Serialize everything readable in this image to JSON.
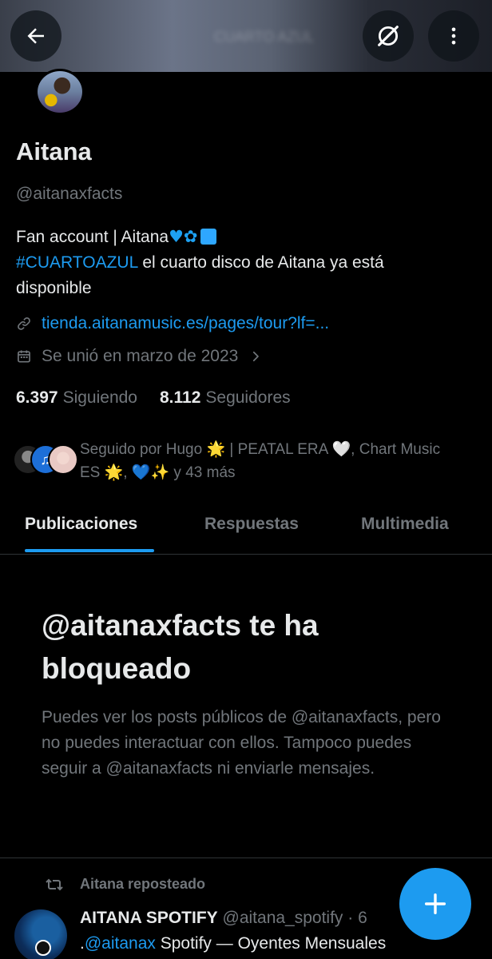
{
  "header": {
    "banner_text": "CUARTO AZUL"
  },
  "profile": {
    "name": "Aitana",
    "handle": "@aitanaxfacts",
    "bio_line1_text": "Fan account |  Aitana",
    "bio_hashtag": "#CUARTOAZUL",
    "bio_line2_rest": " el cuarto disco de Aitana ya está",
    "bio_line3": "disponible",
    "link": "tienda.aitanamusic.es/pages/tour?lf=...",
    "joined": "Se unió en marzo de 2023",
    "following_count": "6.397",
    "following_label": "Siguiendo",
    "followers_count": "8.112",
    "followers_label": "Seguidores",
    "followed_by_line1": "Seguido por Hugo 🌟 | PEATAL ERA 🤍, Chart Music",
    "followed_by_line2": "ES 🌟, 💙✨ y 43 más"
  },
  "tabs": [
    {
      "label": "Publicaciones",
      "active": true
    },
    {
      "label": "Respuestas",
      "active": false
    },
    {
      "label": "Multimedia",
      "active": false
    }
  ],
  "blocked": {
    "title": "@aitanaxfacts te ha bloqueado",
    "description": "Puedes ver los posts públicos de @aitanaxfacts, pero no puedes interactuar con ellos. Tampoco puedes seguir a @aitanaxfacts ni enviarle mensajes."
  },
  "post": {
    "repost_label": "Aitana reposteado",
    "author_name": "AITANA SPOTIFY",
    "author_handle": "@aitana_spotify · 6",
    "body_prefix": ".",
    "body_mention": "@aitanax",
    "body_rest": " Spotify — Oyentes Mensuales"
  },
  "colors": {
    "accent": "#1d9bf0",
    "background": "#000000",
    "secondary_text": "#71767b"
  },
  "icons": {
    "back": "arrow-left-icon",
    "grok": "grok-icon",
    "more": "more-vertical-icon",
    "link": "link-icon",
    "calendar": "calendar-icon",
    "chevron": "chevron-right-icon",
    "repost": "repost-icon",
    "compose": "plus-icon"
  }
}
